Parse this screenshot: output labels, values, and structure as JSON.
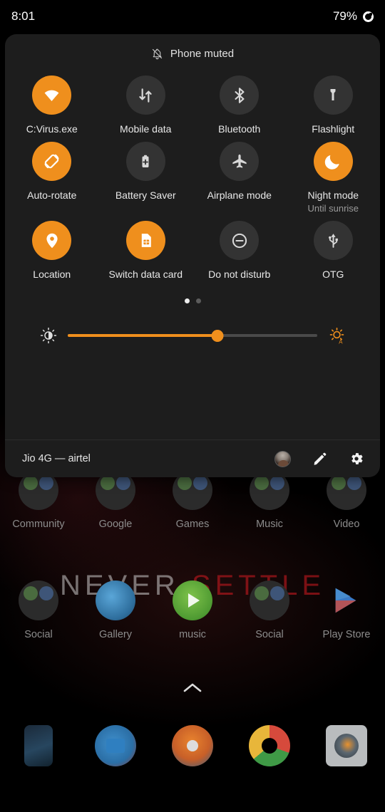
{
  "statusbar": {
    "time": "8:01",
    "battery_percent": "79%",
    "battery_icon": "battery-circle-icon"
  },
  "quick_settings": {
    "header": {
      "text": "Phone muted",
      "icon": "bell-muted-icon"
    },
    "active_color": "#ef8f1d",
    "inactive_color": "#333333",
    "panel_color": "#1d1d1d",
    "tiles": [
      {
        "label": "C:Virus.exe",
        "sub": "",
        "icon": "wifi-icon",
        "active": true
      },
      {
        "label": "Mobile data",
        "sub": "",
        "icon": "mobile-data-icon",
        "active": false
      },
      {
        "label": "Bluetooth",
        "sub": "",
        "icon": "bluetooth-icon",
        "active": false
      },
      {
        "label": "Flashlight",
        "sub": "",
        "icon": "flashlight-icon",
        "active": false
      },
      {
        "label": "Auto-rotate",
        "sub": "",
        "icon": "auto-rotate-icon",
        "active": true
      },
      {
        "label": "Battery Saver",
        "sub": "",
        "icon": "battery-plus-icon",
        "active": false
      },
      {
        "label": "Airplane mode",
        "sub": "",
        "icon": "airplane-icon",
        "active": false
      },
      {
        "label": "Night mode",
        "sub": "Until sunrise",
        "icon": "moon-icon",
        "active": true
      },
      {
        "label": "Location",
        "sub": "",
        "icon": "location-pin-icon",
        "active": true
      },
      {
        "label": "Switch data card",
        "sub": "",
        "icon": "sim-card-icon",
        "active": true
      },
      {
        "label": "Do not disturb",
        "sub": "",
        "icon": "do-not-disturb-icon",
        "active": false
      },
      {
        "label": "OTG",
        "sub": "",
        "icon": "usb-icon",
        "active": false
      }
    ],
    "pages": {
      "count": 2,
      "current": 1
    },
    "brightness": {
      "value_percent": 60,
      "left_icon": "brightness-low-icon",
      "right_icon": "brightness-auto-icon"
    },
    "footer": {
      "carrier": "Jio 4G — airtel",
      "avatar_icon": "user-avatar",
      "edit_icon": "pencil-icon",
      "settings_icon": "gear-icon"
    }
  },
  "home": {
    "wallpaper_text": {
      "first": "NEVER",
      "second": "SETTLE"
    },
    "row1": [
      {
        "label": "Community"
      },
      {
        "label": "Google"
      },
      {
        "label": "Games"
      },
      {
        "label": "Music"
      },
      {
        "label": "Video"
      }
    ],
    "row2": [
      {
        "label": "Social"
      },
      {
        "label": "Gallery"
      },
      {
        "label": "music"
      },
      {
        "label": "Social"
      },
      {
        "label": "Play Store"
      }
    ],
    "dock": [
      {
        "label": "",
        "icon": "phone-app-icon"
      },
      {
        "label": "",
        "icon": "messages-app-icon"
      },
      {
        "label": "",
        "icon": "maps-app-icon"
      },
      {
        "label": "",
        "icon": "chrome-app-icon"
      },
      {
        "label": "",
        "icon": "camera-app-icon"
      }
    ],
    "drawer_arrow_icon": "chevron-up-icon"
  }
}
